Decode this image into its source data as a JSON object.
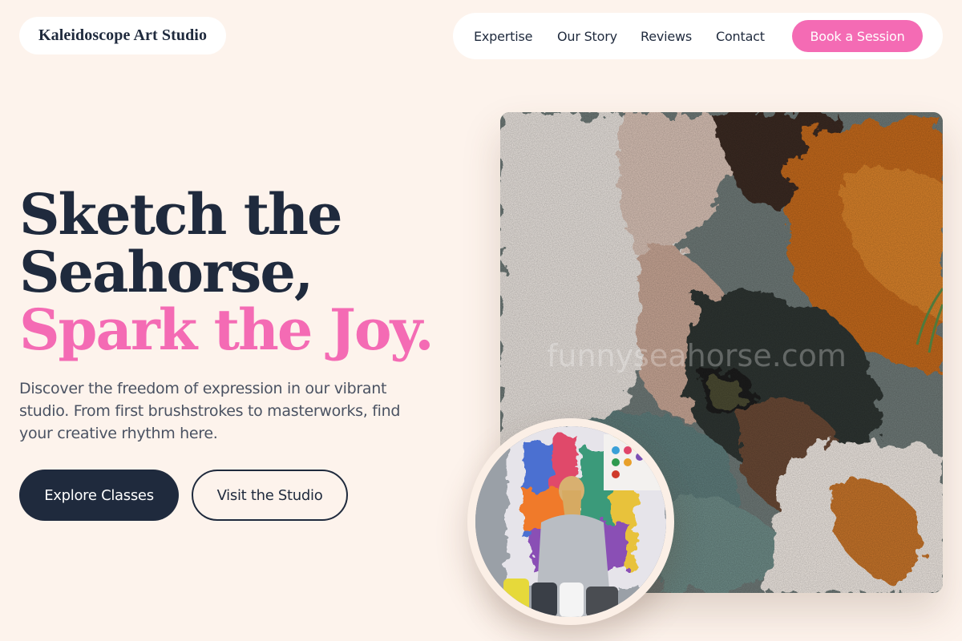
{
  "header": {
    "logo_text": "Kaleidoscope Art Studio",
    "nav": [
      "Expertise",
      "Our Story",
      "Reviews",
      "Contact"
    ],
    "cta_label": "Book a Session"
  },
  "hero": {
    "title_line1": "Sketch the",
    "title_line2": "Seahorse,",
    "title_accent": "Spark the Joy.",
    "description": "Discover the freedom of expression in our vibrant studio. From first brushstrokes to masterworks, find your creative rhythm here.",
    "primary_button": "Explore Classes",
    "secondary_button": "Visit the Studio"
  },
  "images": {
    "main_image": "textured-paint-closeup-photo",
    "circle_image": "child-painting-in-studio-photo",
    "watermark_text": "funnyseahorse.com"
  },
  "colors": {
    "background": "#fdf3ec",
    "navy": "#1f2a3d",
    "pink": "#f46bb4",
    "white": "#ffffff"
  }
}
